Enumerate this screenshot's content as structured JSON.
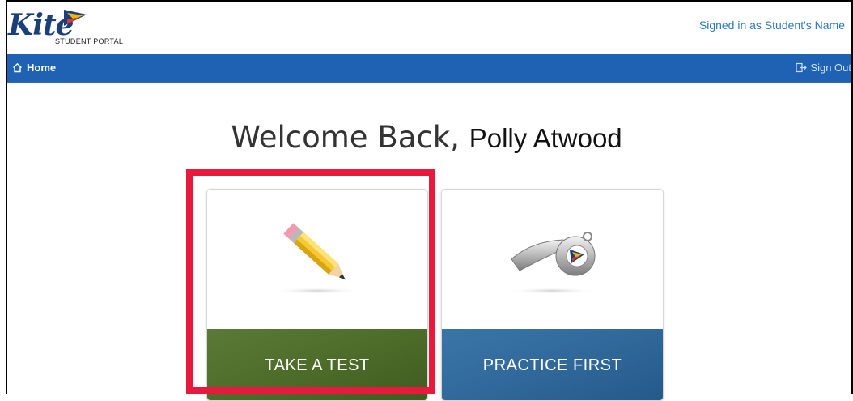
{
  "header": {
    "logo_text": "Kite",
    "logo_subtitle": "STUDENT PORTAL",
    "signed_in": "Signed in as Student's Name"
  },
  "nav": {
    "home_label": "Home",
    "signout_label": "Sign Out"
  },
  "welcome": {
    "greeting": "Welcome Back,",
    "name": "Polly Atwood"
  },
  "cards": [
    {
      "label": "TAKE A TEST",
      "icon": "pencil-icon",
      "color": "#4c6a28"
    },
    {
      "label": "PRACTICE FIRST",
      "icon": "whistle-icon",
      "color": "#2f6799"
    }
  ],
  "colors": {
    "navbar": "#1f62b4",
    "highlight": "#e8193c",
    "link": "#2b78c2"
  }
}
